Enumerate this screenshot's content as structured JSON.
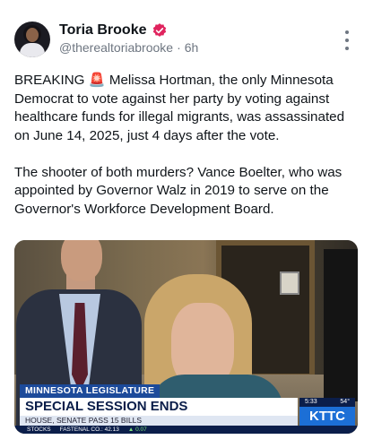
{
  "post": {
    "author_name": "Toria Brooke",
    "handle": "@therealtoriabrooke",
    "separator": "·",
    "time_ago": "6h",
    "paragraphs": [
      "BREAKING 🚨 Melissa Hortman, the only Minnesota Democrat to vote against her party by voting against healthcare funds for illegal migrants, was assassinated on June 14, 2025, just 4 days after the vote.",
      "The shooter of both murders? Vance Boelter, who was appointed by Governor Walz in 2019 to serve on the Governor's Workforce Development Board."
    ]
  },
  "media": {
    "tag": "MINNESOTA LEGISLATURE",
    "headline": "SPECIAL SESSION ENDS",
    "subline": "HOUSE, SENATE PASS 15 BILLS",
    "ticker_label": "STOCKS",
    "ticker_item": "FASTENAL CO.: 42.13",
    "ticker_change": "▲ 0.07",
    "clock": "5:33",
    "temperature": "54°",
    "station": "KTTC"
  },
  "colors": {
    "verified_badge": "#e0245e",
    "lower_third_blue": "#1c4a9a",
    "station_blue": "#1c6fd6"
  },
  "icons": {
    "verified": "verified-badge-icon",
    "more": "more-vertical-icon"
  }
}
